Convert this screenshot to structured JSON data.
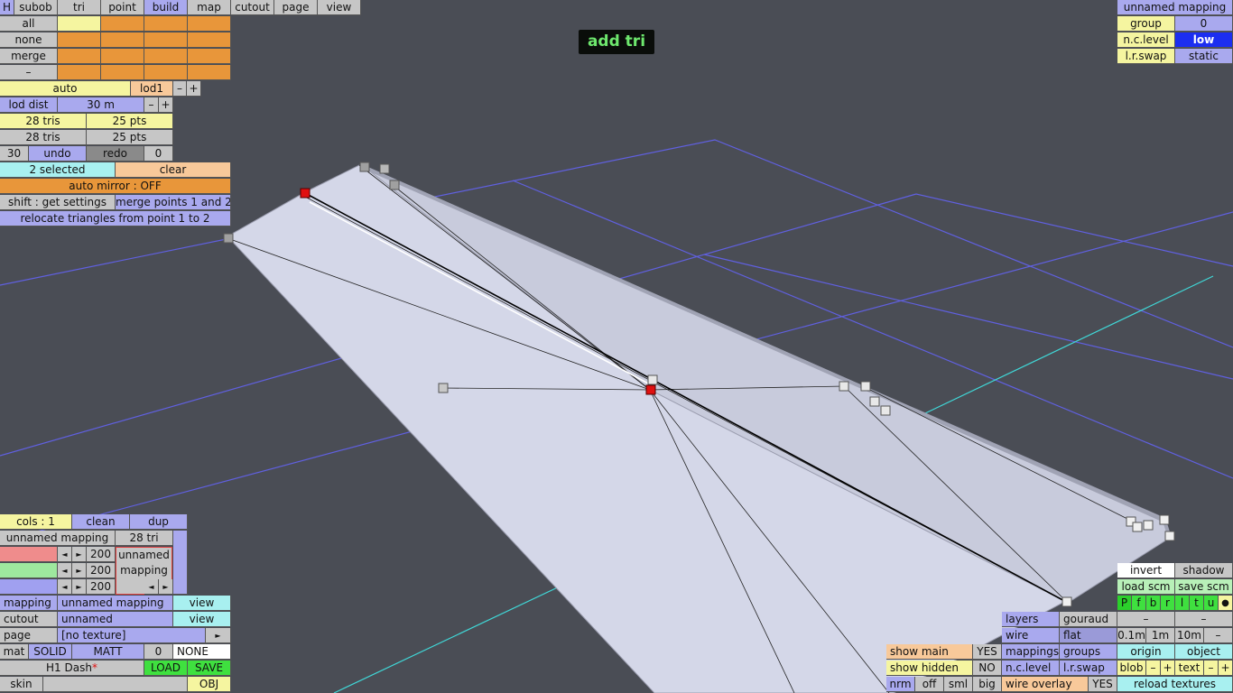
{
  "mode_title": "add tri",
  "menu": {
    "h": "H",
    "subob": "subob",
    "tri": "tri",
    "point": "point",
    "build": "build",
    "map": "map",
    "cutout": "cutout",
    "page": "page",
    "view": "view"
  },
  "select": {
    "all": "all",
    "none": "none",
    "merge": "merge",
    "minus": "–"
  },
  "lod": {
    "auto": "auto",
    "level": "lod1",
    "minus": "–",
    "plus": "+",
    "dist_label": "lod dist",
    "dist_value": "30 m",
    "dist_minus": "–",
    "dist_plus": "+",
    "tris_a": "28 tris",
    "pts_a": "25 pts",
    "tris_b": "28 tris",
    "pts_b": "25 pts"
  },
  "history": {
    "count": "30",
    "undo": "undo",
    "redo": "redo",
    "redo_count": "0"
  },
  "selection": {
    "selected": "2 selected",
    "clear": "clear",
    "auto_mirror": "auto mirror : OFF",
    "shift_get": "shift : get settings",
    "merge_points": "merge points 1 and 2",
    "relocate": "relocate triangles from point 1 to 2"
  },
  "mapping_panel": {
    "name": "unnamed mapping",
    "group_label": "group",
    "group_value": "0",
    "nc_label": "n.c.level",
    "nc_value": "low",
    "lr_label": "l.r.swap",
    "lr_value": "static"
  },
  "colors_panel": {
    "cols": "cols : 1",
    "clean": "clean",
    "dup": "dup",
    "mapping_name": "unnamed mapping",
    "tri_count": "28 tri",
    "r_value": "200",
    "g_value": "200",
    "b_value": "200",
    "preview_line1": "unnamed",
    "preview_line2": "mapping",
    "left_arrow": "◄",
    "right_arrow": "►"
  },
  "props": {
    "mapping_label": "mapping",
    "mapping_value": "unnamed mapping",
    "mapping_view": "view",
    "cutout_label": "cutout",
    "cutout_value": "unnamed",
    "cutout_view": "view",
    "page_label": "page",
    "page_value": "[no texture]",
    "page_arrow": "►",
    "mat_label": "mat",
    "mat_solid": "SOLID",
    "mat_matt": "MATT",
    "mat_num": "0",
    "mat_none": "NONE",
    "file_name": "H1 Dash",
    "file_star": "*",
    "load": "LOAD",
    "save": "SAVE",
    "skin": "skin",
    "obj": "OBJ"
  },
  "view_panel": {
    "show_main": "show main",
    "show_main_val": "YES",
    "show_hidden": "show hidden",
    "show_hidden_val": "NO",
    "nrm": "nrm",
    "off": "off",
    "sml": "sml",
    "big": "big",
    "layers": "layers",
    "gouraud": "gouraud",
    "wire": "wire",
    "flat": "flat",
    "mappings": "mappings",
    "groups": "groups",
    "nc_level": "n.c.level",
    "lr_swap": "l.r.swap",
    "wire_overlay": "wire overlay",
    "wire_overlay_val": "YES",
    "invert": "invert",
    "shadow": "shadow",
    "load_scm": "load scm",
    "save_scm": "save scm",
    "flags": [
      "P",
      "f",
      "b",
      "r",
      "l",
      "t",
      "u"
    ],
    "dot": "●",
    "dash1": "–",
    "dash2": "–",
    "step1": "0.1m",
    "step2": "1m",
    "step3": "10m",
    "step_minus": "–",
    "origin": "origin",
    "object": "object",
    "blob": "blob",
    "blob_minus": "–",
    "blob_plus": "+",
    "text": "text",
    "text_minus": "–",
    "text_plus": "+",
    "reload": "reload textures"
  },
  "colors": {
    "background": "#4a4d55",
    "mesh": "#d4d7e8",
    "grid_blue": "#6060e0",
    "grid_cyan": "#40d8d8",
    "selected_point": "#e01010",
    "title_text": "#6ee86e"
  }
}
